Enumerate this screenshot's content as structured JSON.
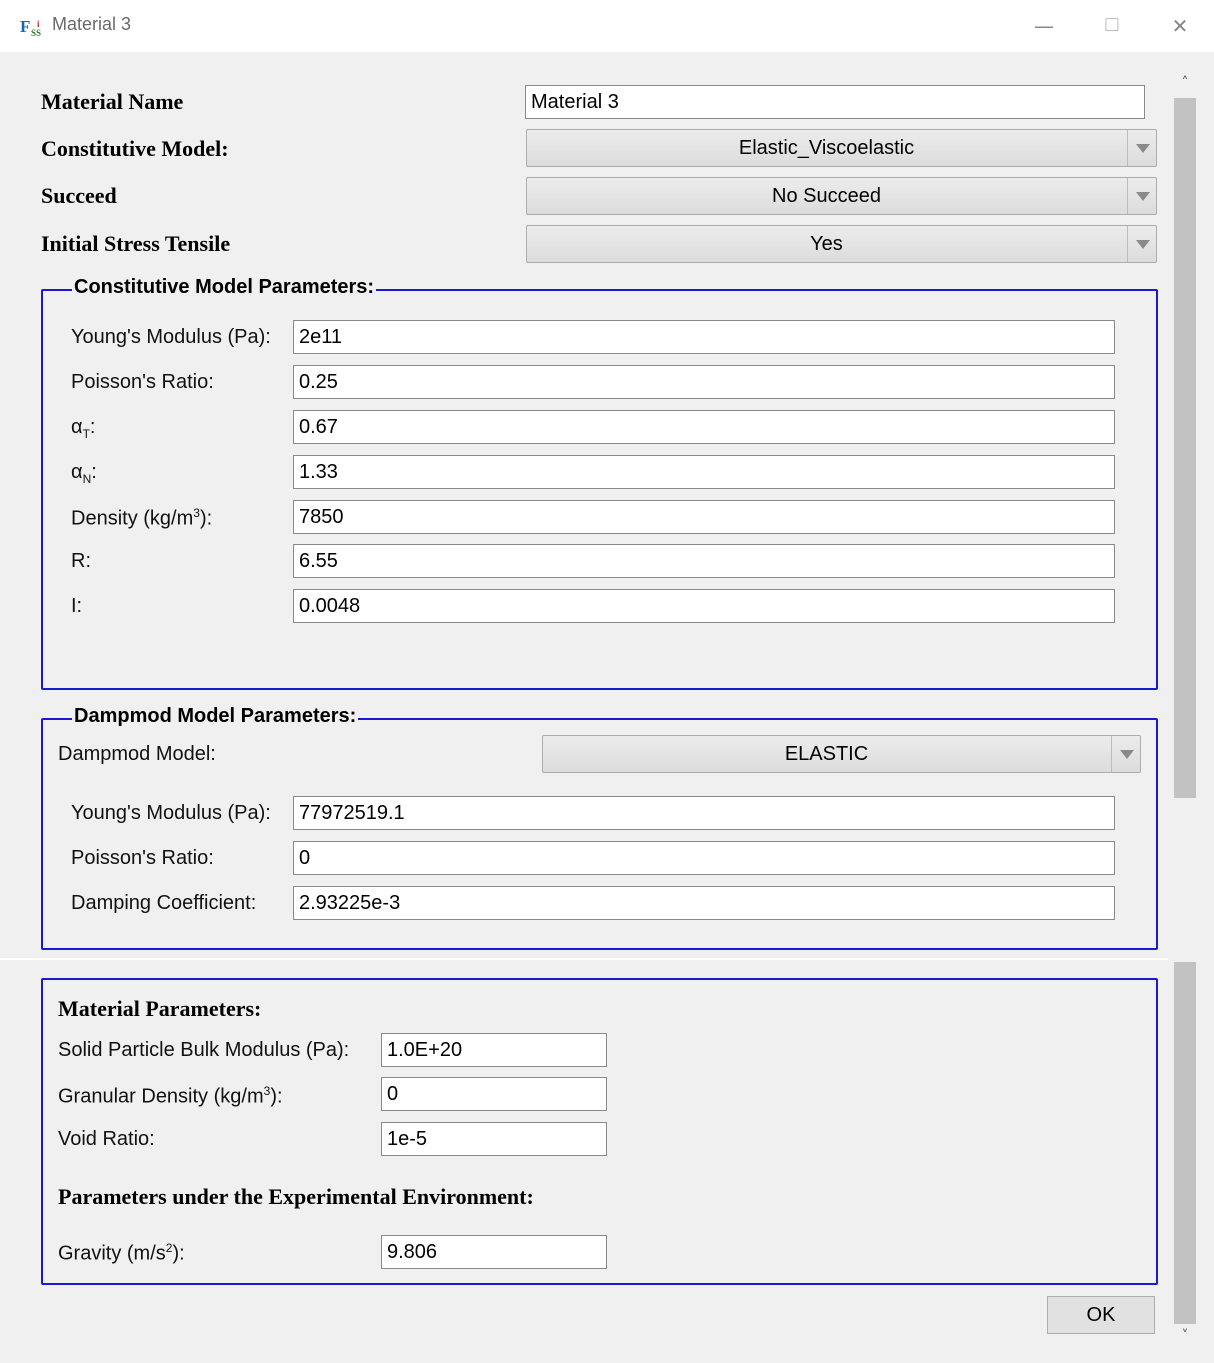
{
  "window": {
    "title": "Material 3"
  },
  "form": {
    "material_name_label": "Material Name",
    "material_name_value": "Material 3",
    "constitutive_model_label": "Constitutive Model:",
    "constitutive_model_value": "Elastic_Viscoelastic",
    "succeed_label": "Succeed",
    "succeed_value": "No Succeed",
    "initial_stress_label": "Initial Stress Tensile",
    "initial_stress_value": "Yes"
  },
  "constitutive_params": {
    "title": "Constitutive Model Parameters:",
    "youngs_label": "Young's Modulus (Pa):",
    "youngs_value": "2e11",
    "poisson_label": "Poisson's Ratio:",
    "poisson_value": "0.25",
    "alpha_t_symbol": "α",
    "alpha_t_sub": "T",
    "alpha_t_value": "0.67",
    "alpha_n_symbol": "α",
    "alpha_n_sub": "N",
    "alpha_n_value": "1.33",
    "density_label_prefix": "Density (kg/m",
    "density_label_sup": "3",
    "density_label_suffix": "):",
    "density_value": "7850",
    "r_label": "R:",
    "r_value": "6.55",
    "i_label": "I:",
    "i_value": "0.0048"
  },
  "dampmod_params": {
    "title": "Dampmod Model Parameters:",
    "model_label": "Dampmod Model:",
    "model_value": "ELASTIC",
    "youngs_label": "Young's Modulus (Pa):",
    "youngs_value": "77972519.1",
    "poisson_label": "Poisson's Ratio:",
    "poisson_value": "0",
    "damping_label": "Damping Coefficient:",
    "damping_value": "2.93225e-3"
  },
  "material_params": {
    "title": "Material Parameters:",
    "bulk_label": "Solid Particle Bulk Modulus (Pa):",
    "bulk_value": "1.0E+20",
    "granular_label_prefix": "Granular Density (kg/m",
    "granular_label_sup": "3",
    "granular_label_suffix": "):",
    "granular_value": "0",
    "void_label": "Void Ratio:",
    "void_value": "1e-5",
    "env_title": "Parameters under the Experimental Environment:",
    "gravity_label_prefix": "Gravity (m/s",
    "gravity_label_sup": "2",
    "gravity_label_suffix": "):",
    "gravity_value": "9.806"
  },
  "buttons": {
    "ok": "OK"
  },
  "icons": [
    "app-icon",
    "minimize-icon",
    "maximize-icon",
    "close-icon",
    "scroll-up-icon",
    "scroll-down-icon",
    "dropdown-arrow-icon"
  ]
}
